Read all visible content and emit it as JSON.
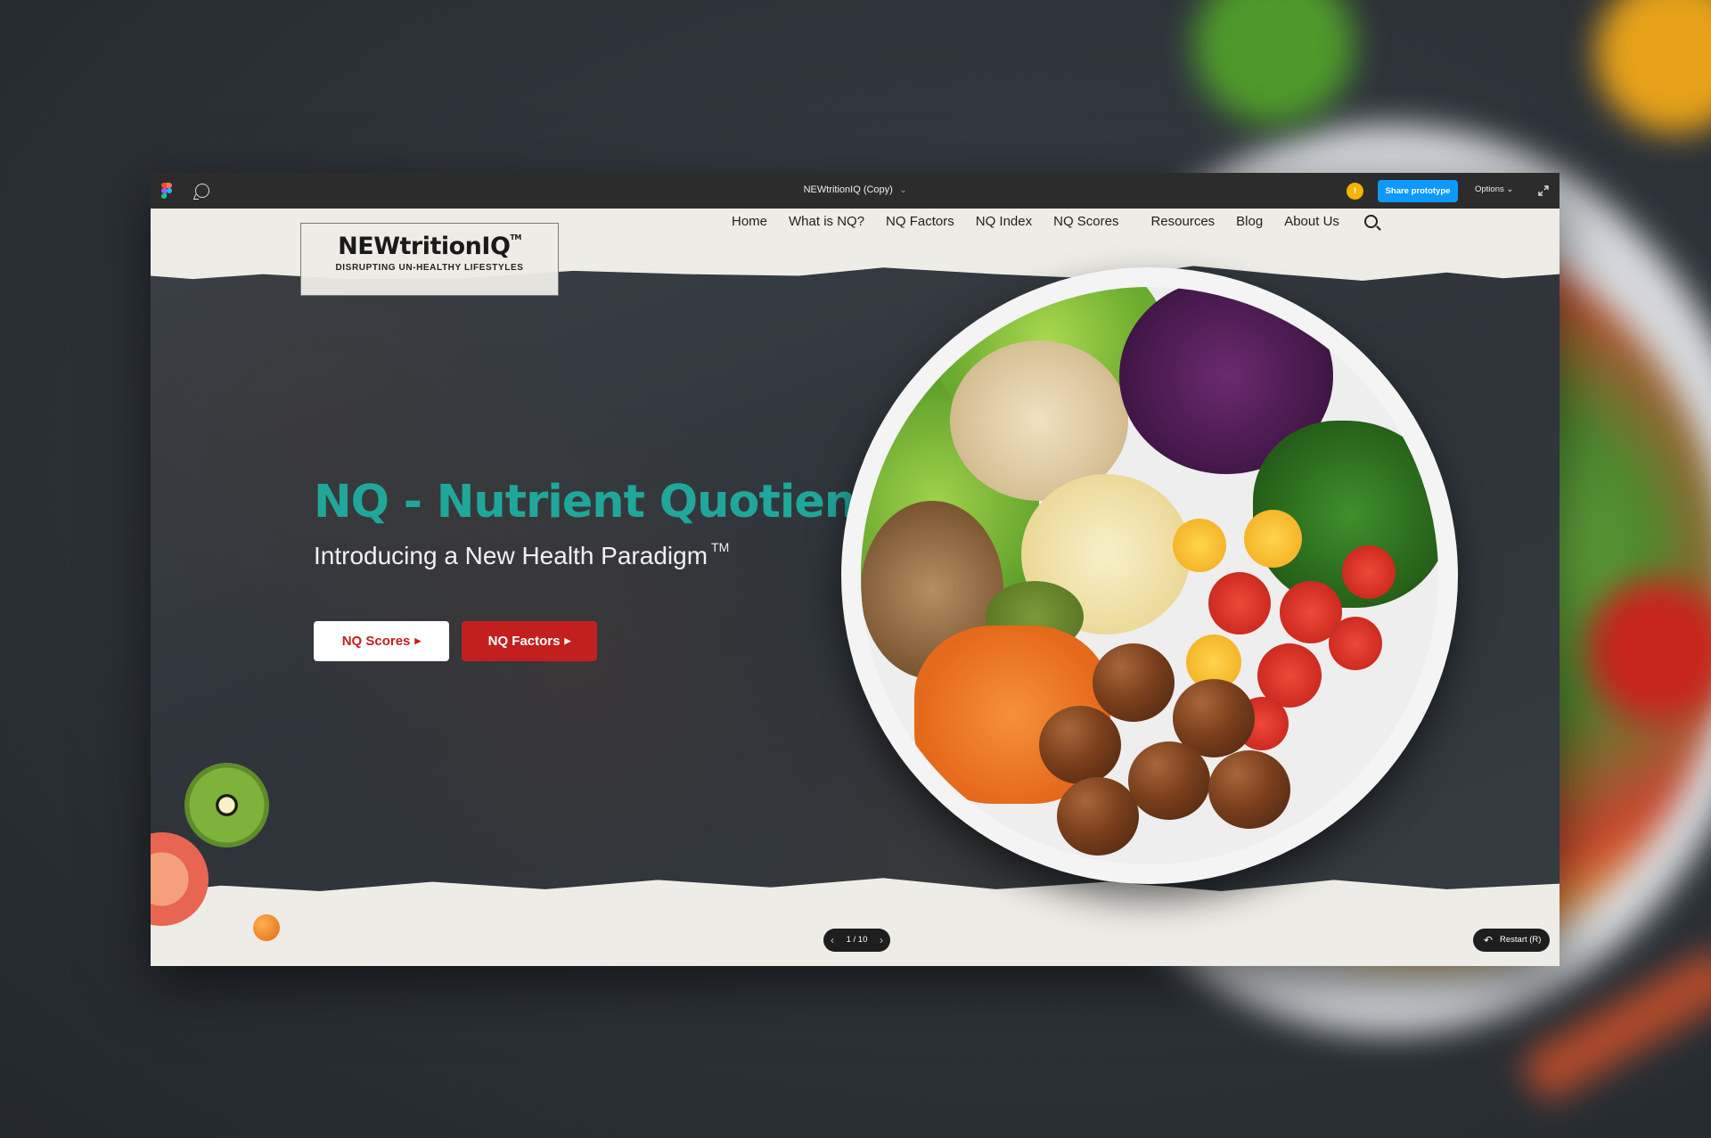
{
  "figma": {
    "file_title": "NEWtritionIQ (Copy)",
    "avatar_initial": "I",
    "share_label": "Share prototype",
    "options_label": "Options"
  },
  "site": {
    "logo": {
      "name": "NEWtritionIQ",
      "tm": "TM",
      "tagline": "DISRUPTING  UN-HEALTHY  LIFESTYLES"
    },
    "nav": [
      "Home",
      "What is NQ?",
      "NQ Factors",
      "NQ Index",
      "NQ Scores",
      "Resources",
      "Blog",
      "About Us"
    ],
    "headline": "NQ - Nutrient Quotient",
    "subhead": "Introducing a New Health Paradigm",
    "subhead_tm": "TM",
    "buttons": {
      "scores": "NQ Scores",
      "factors": "NQ Factors"
    }
  },
  "prototype": {
    "page_indicator": "1 / 10",
    "restart_label": "Restart (R)"
  },
  "colors": {
    "accent_teal": "#1fa89a",
    "cta_red": "#c41f1f",
    "figma_blue": "#0d99ff"
  },
  "icons": [
    "figma-logo-icon",
    "comment-icon",
    "chevron-down-icon",
    "expand-icon",
    "search-icon",
    "chevron-left-icon",
    "chevron-right-icon",
    "restart-icon"
  ]
}
